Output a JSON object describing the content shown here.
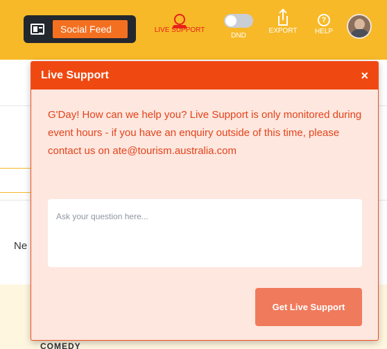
{
  "topbar": {
    "feed_button_label": "Social Feed",
    "nav": {
      "live_support": "LIVE SUPPORT",
      "dnd": "DND",
      "export": "EXPORT",
      "help": "HELP"
    },
    "help_icon_glyph": "?",
    "dnd_enabled": false,
    "colors": {
      "bar": "#f7b928",
      "accent": "#f37021",
      "live_support": "#e8201c"
    }
  },
  "background": {
    "partial_text": "Ne",
    "partial_logo": "COMEDY"
  },
  "live_support_panel": {
    "title": "Live Support",
    "close_glyph": "×",
    "message": "G'Day! How can we help you? Live Support is only monitored during event hours - if you have an enquiry outside of this time, please contact us on ate@tourism.australia.com",
    "question_placeholder": "Ask your question here...",
    "question_value": "",
    "submit_label": "Get Live Support",
    "colors": {
      "header": "#f04811",
      "body": "#fde7df",
      "text": "#e3431b",
      "button": "#f07a5c"
    }
  },
  "icons": [
    "id-card-icon",
    "headset-icon",
    "toggle-icon",
    "export-icon",
    "help-icon",
    "avatar"
  ]
}
